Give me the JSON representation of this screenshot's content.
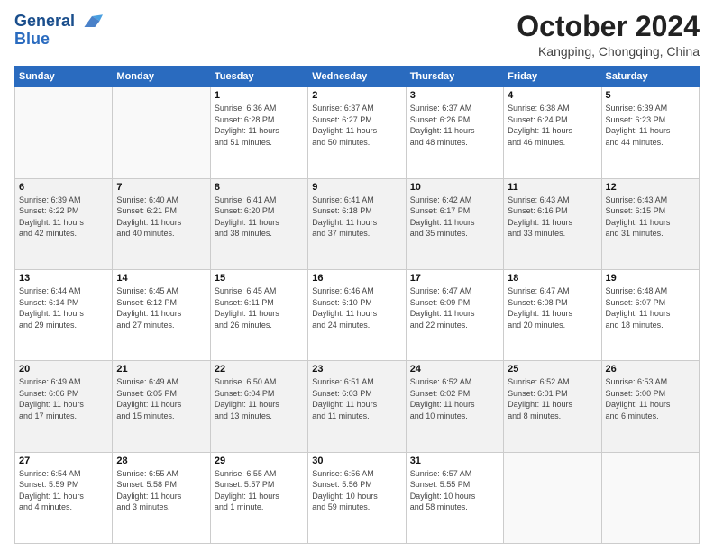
{
  "header": {
    "logo_line1": "General",
    "logo_line2": "Blue",
    "month": "October 2024",
    "location": "Kangping, Chongqing, China"
  },
  "weekdays": [
    "Sunday",
    "Monday",
    "Tuesday",
    "Wednesday",
    "Thursday",
    "Friday",
    "Saturday"
  ],
  "weeks": [
    [
      {
        "day": "",
        "detail": ""
      },
      {
        "day": "",
        "detail": ""
      },
      {
        "day": "1",
        "detail": "Sunrise: 6:36 AM\nSunset: 6:28 PM\nDaylight: 11 hours\nand 51 minutes."
      },
      {
        "day": "2",
        "detail": "Sunrise: 6:37 AM\nSunset: 6:27 PM\nDaylight: 11 hours\nand 50 minutes."
      },
      {
        "day": "3",
        "detail": "Sunrise: 6:37 AM\nSunset: 6:26 PM\nDaylight: 11 hours\nand 48 minutes."
      },
      {
        "day": "4",
        "detail": "Sunrise: 6:38 AM\nSunset: 6:24 PM\nDaylight: 11 hours\nand 46 minutes."
      },
      {
        "day": "5",
        "detail": "Sunrise: 6:39 AM\nSunset: 6:23 PM\nDaylight: 11 hours\nand 44 minutes."
      }
    ],
    [
      {
        "day": "6",
        "detail": "Sunrise: 6:39 AM\nSunset: 6:22 PM\nDaylight: 11 hours\nand 42 minutes."
      },
      {
        "day": "7",
        "detail": "Sunrise: 6:40 AM\nSunset: 6:21 PM\nDaylight: 11 hours\nand 40 minutes."
      },
      {
        "day": "8",
        "detail": "Sunrise: 6:41 AM\nSunset: 6:20 PM\nDaylight: 11 hours\nand 38 minutes."
      },
      {
        "day": "9",
        "detail": "Sunrise: 6:41 AM\nSunset: 6:18 PM\nDaylight: 11 hours\nand 37 minutes."
      },
      {
        "day": "10",
        "detail": "Sunrise: 6:42 AM\nSunset: 6:17 PM\nDaylight: 11 hours\nand 35 minutes."
      },
      {
        "day": "11",
        "detail": "Sunrise: 6:43 AM\nSunset: 6:16 PM\nDaylight: 11 hours\nand 33 minutes."
      },
      {
        "day": "12",
        "detail": "Sunrise: 6:43 AM\nSunset: 6:15 PM\nDaylight: 11 hours\nand 31 minutes."
      }
    ],
    [
      {
        "day": "13",
        "detail": "Sunrise: 6:44 AM\nSunset: 6:14 PM\nDaylight: 11 hours\nand 29 minutes."
      },
      {
        "day": "14",
        "detail": "Sunrise: 6:45 AM\nSunset: 6:12 PM\nDaylight: 11 hours\nand 27 minutes."
      },
      {
        "day": "15",
        "detail": "Sunrise: 6:45 AM\nSunset: 6:11 PM\nDaylight: 11 hours\nand 26 minutes."
      },
      {
        "day": "16",
        "detail": "Sunrise: 6:46 AM\nSunset: 6:10 PM\nDaylight: 11 hours\nand 24 minutes."
      },
      {
        "day": "17",
        "detail": "Sunrise: 6:47 AM\nSunset: 6:09 PM\nDaylight: 11 hours\nand 22 minutes."
      },
      {
        "day": "18",
        "detail": "Sunrise: 6:47 AM\nSunset: 6:08 PM\nDaylight: 11 hours\nand 20 minutes."
      },
      {
        "day": "19",
        "detail": "Sunrise: 6:48 AM\nSunset: 6:07 PM\nDaylight: 11 hours\nand 18 minutes."
      }
    ],
    [
      {
        "day": "20",
        "detail": "Sunrise: 6:49 AM\nSunset: 6:06 PM\nDaylight: 11 hours\nand 17 minutes."
      },
      {
        "day": "21",
        "detail": "Sunrise: 6:49 AM\nSunset: 6:05 PM\nDaylight: 11 hours\nand 15 minutes."
      },
      {
        "day": "22",
        "detail": "Sunrise: 6:50 AM\nSunset: 6:04 PM\nDaylight: 11 hours\nand 13 minutes."
      },
      {
        "day": "23",
        "detail": "Sunrise: 6:51 AM\nSunset: 6:03 PM\nDaylight: 11 hours\nand 11 minutes."
      },
      {
        "day": "24",
        "detail": "Sunrise: 6:52 AM\nSunset: 6:02 PM\nDaylight: 11 hours\nand 10 minutes."
      },
      {
        "day": "25",
        "detail": "Sunrise: 6:52 AM\nSunset: 6:01 PM\nDaylight: 11 hours\nand 8 minutes."
      },
      {
        "day": "26",
        "detail": "Sunrise: 6:53 AM\nSunset: 6:00 PM\nDaylight: 11 hours\nand 6 minutes."
      }
    ],
    [
      {
        "day": "27",
        "detail": "Sunrise: 6:54 AM\nSunset: 5:59 PM\nDaylight: 11 hours\nand 4 minutes."
      },
      {
        "day": "28",
        "detail": "Sunrise: 6:55 AM\nSunset: 5:58 PM\nDaylight: 11 hours\nand 3 minutes."
      },
      {
        "day": "29",
        "detail": "Sunrise: 6:55 AM\nSunset: 5:57 PM\nDaylight: 11 hours\nand 1 minute."
      },
      {
        "day": "30",
        "detail": "Sunrise: 6:56 AM\nSunset: 5:56 PM\nDaylight: 10 hours\nand 59 minutes."
      },
      {
        "day": "31",
        "detail": "Sunrise: 6:57 AM\nSunset: 5:55 PM\nDaylight: 10 hours\nand 58 minutes."
      },
      {
        "day": "",
        "detail": ""
      },
      {
        "day": "",
        "detail": ""
      }
    ]
  ]
}
